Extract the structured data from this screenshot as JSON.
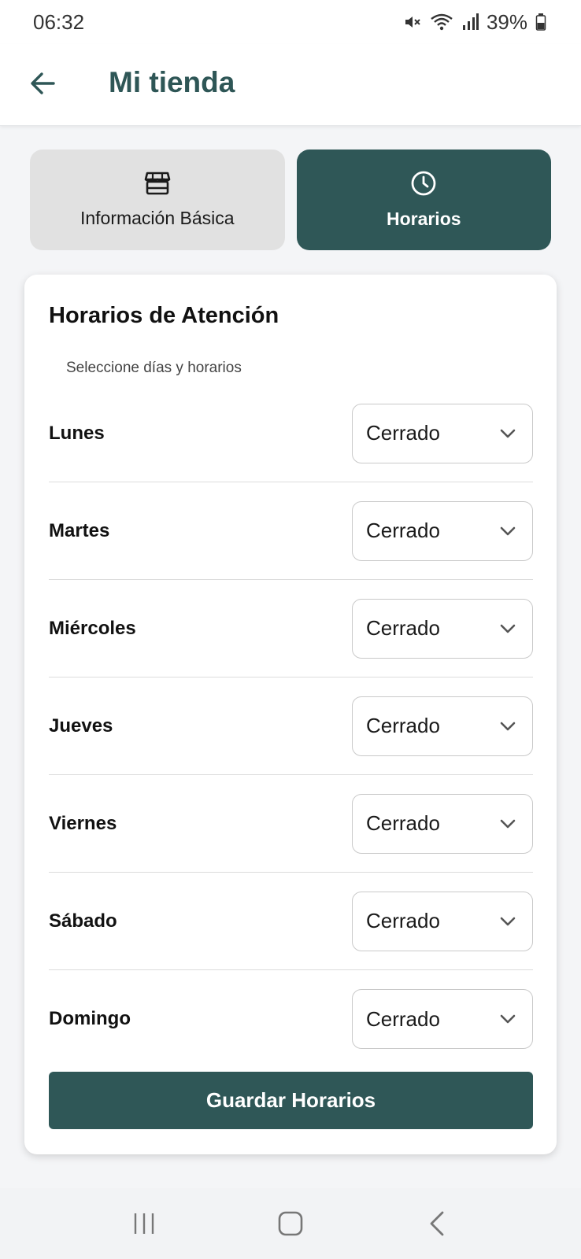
{
  "status": {
    "time": "06:32",
    "battery": "39%"
  },
  "appbar": {
    "title": "Mi tienda"
  },
  "tabs": [
    {
      "label": "Información Básica",
      "icon": "store-icon",
      "active": false
    },
    {
      "label": "Horarios",
      "icon": "clock-icon",
      "active": true
    }
  ],
  "card": {
    "title": "Horarios de Atención",
    "subtitle": "Seleccione días y horarios",
    "days": [
      {
        "day": "Lunes",
        "value": "Cerrado"
      },
      {
        "day": "Martes",
        "value": "Cerrado"
      },
      {
        "day": "Miércoles",
        "value": "Cerrado"
      },
      {
        "day": "Jueves",
        "value": "Cerrado"
      },
      {
        "day": "Viernes",
        "value": "Cerrado"
      },
      {
        "day": "Sábado",
        "value": "Cerrado"
      },
      {
        "day": "Domingo",
        "value": "Cerrado"
      }
    ],
    "save_label": "Guardar Horarios"
  },
  "colors": {
    "primary": "#2f5757",
    "title": "#2e5656",
    "inactive_tab": "#e1e1e1"
  }
}
